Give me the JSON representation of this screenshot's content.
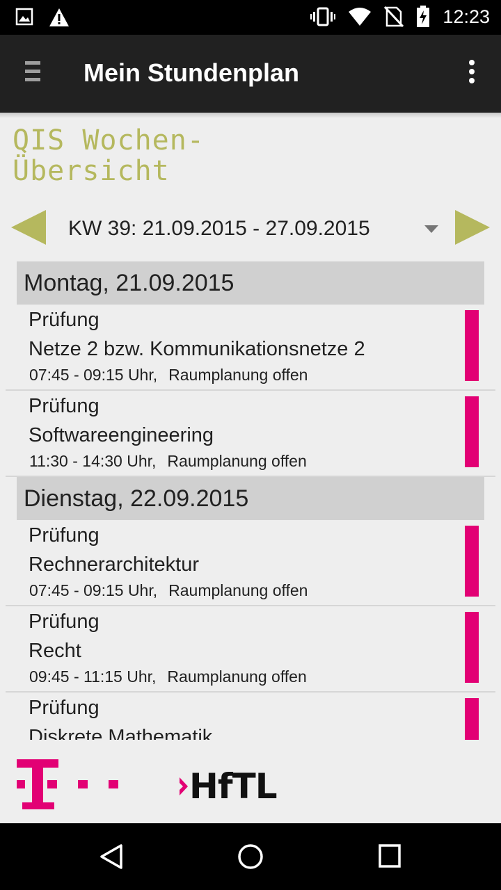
{
  "status_bar": {
    "time": "12:23",
    "left_icons": [
      "image-icon",
      "warning-icon"
    ],
    "right_icons": [
      "vibrate-icon",
      "wifi-icon",
      "no-sim-icon",
      "battery-charging-icon"
    ]
  },
  "toolbar": {
    "title": "Mein Stundenplan",
    "menu_icon": "hamburger-menu-icon",
    "overflow_icon": "more-vert-icon",
    "background": "#212121"
  },
  "heading": {
    "line1": "QIS Wochen-",
    "line2": "Übersicht",
    "color": "#b5b85e"
  },
  "week_selector": {
    "label": "KW 39: 21.09.2015 - 27.09.2015",
    "prev_icon": "arrow-left-icon",
    "next_icon": "arrow-right-icon",
    "dropdown_icon": "dropdown-caret-icon"
  },
  "days": [
    {
      "label": "Montag, 21.09.2015",
      "entries": [
        {
          "type": "Prüfung",
          "course": "Netze 2 bzw. Kommunikationsnetze 2",
          "time": "07:45 - 09:15 Uhr,",
          "room": "Raumplanung offen"
        },
        {
          "type": "Prüfung",
          "course": "Softwareengineering",
          "time": "11:30 - 14:30 Uhr,",
          "room": "Raumplanung offen"
        }
      ]
    },
    {
      "label": "Dienstag, 22.09.2015",
      "entries": [
        {
          "type": "Prüfung",
          "course": "Rechnerarchitektur",
          "time": "07:45 - 09:15 Uhr,",
          "room": "Raumplanung offen"
        },
        {
          "type": "Prüfung",
          "course": "Recht",
          "time": "09:45 - 11:15 Uhr,",
          "room": "Raumplanung offen"
        },
        {
          "type": "Prüfung",
          "course": "Diskrete Mathematik",
          "time": "",
          "room": ""
        }
      ]
    }
  ],
  "colors": {
    "accent": "#e20074",
    "olive": "#b5b85e",
    "day_header_bg": "#d0d0d0"
  },
  "logos": {
    "telekom_logo": "telekom-logo",
    "hftl_text": "HfTL"
  },
  "nav_bar": {
    "icons": [
      "back-icon",
      "home-icon",
      "recents-icon"
    ]
  }
}
